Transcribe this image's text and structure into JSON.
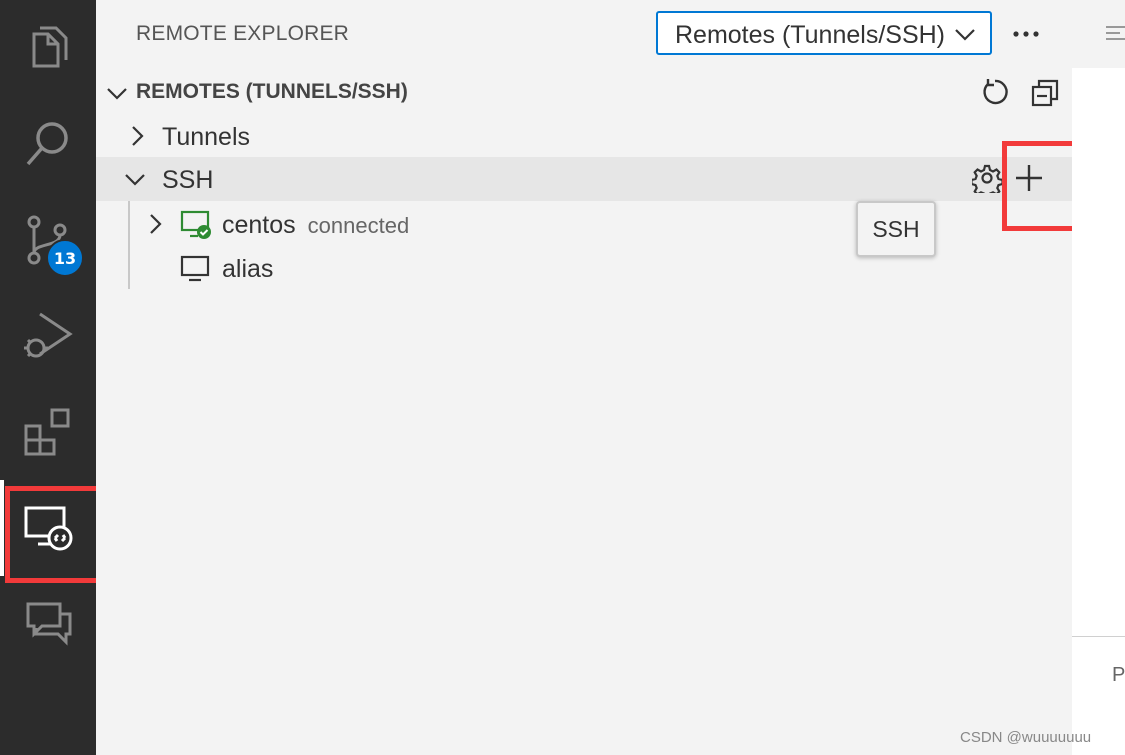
{
  "activity_bar": {
    "items": [
      {
        "name": "explorer-icon"
      },
      {
        "name": "search-icon"
      },
      {
        "name": "source-control-icon",
        "badge": "13"
      },
      {
        "name": "run-debug-icon"
      },
      {
        "name": "extensions-icon"
      },
      {
        "name": "remote-explorer-icon",
        "active": true
      },
      {
        "name": "chat-icon"
      }
    ]
  },
  "sidebar": {
    "title": "REMOTE EXPLORER",
    "dropdown": {
      "value": "Remotes (Tunnels/SSH)"
    },
    "section": {
      "title": "REMOTES (TUNNELS/SSH)",
      "items": [
        {
          "label": "Tunnels",
          "expanded": false
        },
        {
          "label": "SSH",
          "expanded": true
        }
      ],
      "ssh_hosts": [
        {
          "label": "centos",
          "description": "connected",
          "status": "connected"
        },
        {
          "label": "alias"
        }
      ]
    },
    "tooltip": "SSH"
  },
  "editor": {
    "partial_label": "P"
  },
  "watermark": "CSDN @wuuuuuuu",
  "colors": {
    "activity_bg": "#2c2c2c",
    "sidebar_bg": "#f3f3f3",
    "accent": "#0078d4",
    "connected_green": "#2e8b32",
    "highlight_red": "#f23a3a"
  }
}
